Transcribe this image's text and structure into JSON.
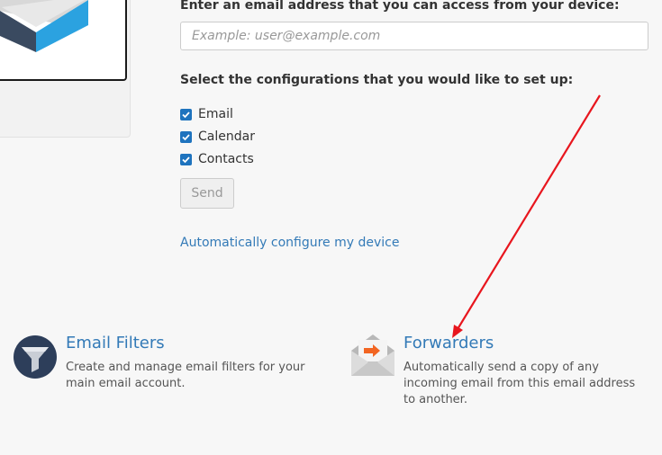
{
  "email_section": {
    "label": "Enter an email address that you can access from your device:",
    "placeholder": "Example: user@example.com",
    "value": ""
  },
  "config_section": {
    "label": "Select the configurations that you would like to set up:",
    "options": [
      {
        "label": "Email",
        "checked": true
      },
      {
        "label": "Calendar",
        "checked": true
      },
      {
        "label": "Contacts",
        "checked": true
      }
    ],
    "send_label": "Send",
    "auto_link": "Automatically configure my device"
  },
  "tiles": [
    {
      "title": "Email Filters",
      "description": "Create and manage email filters for your main email account.",
      "icon": "filter-icon"
    },
    {
      "title": "Forwarders",
      "description": "Automatically send a copy of any incoming email from this email address to another.",
      "icon": "envelope-forward-icon"
    }
  ],
  "colors": {
    "link": "#337ab7",
    "checkbox": "#1e73be",
    "annotation_arrow": "#e8161e",
    "filter_icon_bg": "#2d3e5a",
    "forward_accent": "#f26522"
  }
}
